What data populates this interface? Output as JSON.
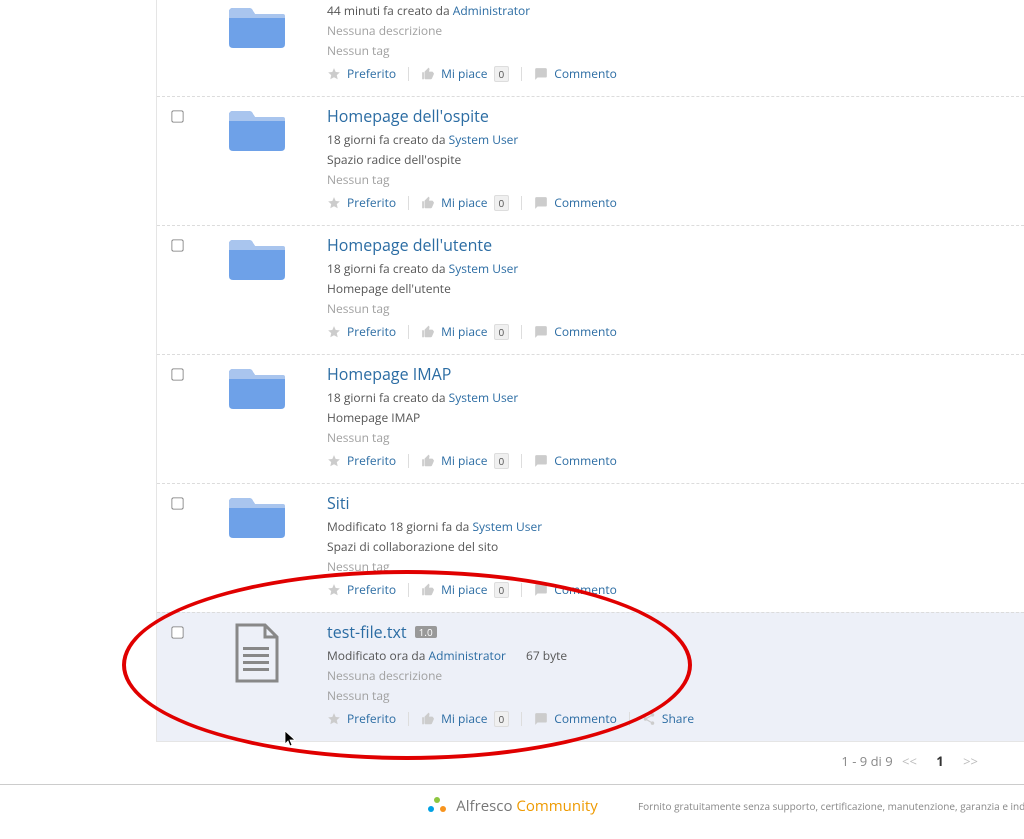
{
  "labels": {
    "preferito": "Preferito",
    "mipiace": "Mi piace",
    "commento": "Commento",
    "share": "Share",
    "nessuna_descrizione": "Nessuna descrizione",
    "nessun_tag": "Nessun tag",
    "creato_da": "creato da",
    "modificato": "Modificato",
    "da": "da"
  },
  "items": [
    {
      "title": "",
      "time": "44 minuti fa",
      "action": "creato da",
      "user": "Administrator",
      "desc": "Nessuna descrizione",
      "tag": "Nessun tag",
      "type": "folder",
      "like_count": "0",
      "show_title": false,
      "show_chk": false
    },
    {
      "title": "Homepage dell'ospite",
      "time": "18 giorni fa",
      "action": "creato da",
      "user": "System User",
      "desc": "Spazio radice dell'ospite",
      "tag": "Nessun tag",
      "type": "folder",
      "like_count": "0",
      "show_title": true,
      "show_chk": true
    },
    {
      "title": "Homepage dell'utente",
      "time": "18 giorni fa",
      "action": "creato da",
      "user": "System User",
      "desc": "Homepage dell'utente",
      "tag": "Nessun tag",
      "type": "folder",
      "like_count": "0",
      "show_title": true,
      "show_chk": true
    },
    {
      "title": "Homepage IMAP",
      "time": "18 giorni fa",
      "action": "creato da",
      "user": "System User",
      "desc": "Homepage IMAP",
      "tag": "Nessun tag",
      "type": "folder",
      "like_count": "0",
      "show_title": true,
      "show_chk": true
    },
    {
      "title": "Siti",
      "time_prefix": "Modificato 18 giorni fa da",
      "user": "System User",
      "desc": "Spazi di collaborazione del sito",
      "tag": "Nessun tag",
      "type": "folder",
      "like_count": "0",
      "show_title": true,
      "show_chk": true,
      "modified": true
    },
    {
      "title": "test-file.txt",
      "version": "1.0",
      "time_prefix": "Modificato ora da",
      "user": "Administrator",
      "size": "67 byte",
      "desc": "Nessuna descrizione",
      "tag": "Nessun tag",
      "type": "file",
      "like_count": "0",
      "show_title": true,
      "show_chk": true,
      "modified": true,
      "share": true,
      "highlight": true
    }
  ],
  "paginator": {
    "summary": "1 - 9 di 9",
    "prev": "<<",
    "current": "1",
    "next": ">>"
  },
  "footer": {
    "brand1": "Alfresco",
    "brand2": "Community",
    "disclaimer": "Fornito gratuitamente senza supporto, certificazione, manutenzione, garanzia e indennità da"
  }
}
